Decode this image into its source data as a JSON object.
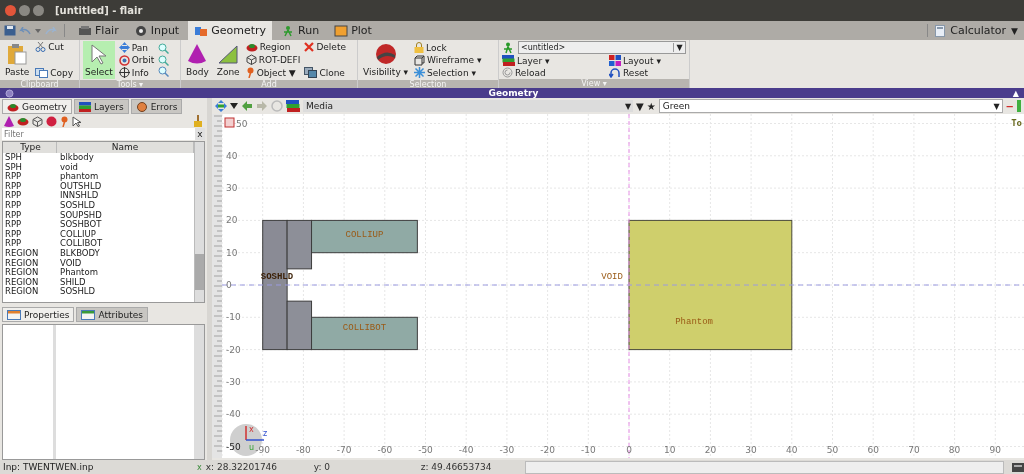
{
  "window": {
    "title": "[untitled] - flair"
  },
  "tabs": [
    {
      "label": "Flair",
      "selected": false
    },
    {
      "label": "Input",
      "selected": false
    },
    {
      "label": "Geometry",
      "selected": true
    },
    {
      "label": "Run",
      "selected": false
    },
    {
      "label": "Plot",
      "selected": false
    }
  ],
  "calculator": {
    "label": "Calculator",
    "caret": "▼"
  },
  "ribbon": {
    "clipboard": {
      "label": "Clipboard",
      "paste": "Paste",
      "cut": "Cut",
      "copy": "Copy"
    },
    "tools": {
      "label": "Tools ▾",
      "select": {
        "label": "Select",
        "selected": true
      },
      "pan": "Pan",
      "orbit": "Orbit",
      "info": "Info"
    },
    "add": {
      "label": "Add",
      "body": "Body",
      "zone": "Zone",
      "region": "Region",
      "rot_defi": "ROT-DEFI",
      "object": "Object ▼",
      "delete": "Delete",
      "clone": "Clone"
    },
    "selection": {
      "label": "Selection",
      "visibility": "Visibility ▾",
      "lock": "Lock",
      "wireframe": "Wireframe ▾",
      "selection": "Selection ▾"
    },
    "view": {
      "label": "View ▾",
      "combo": "<untitled>",
      "combo_caret": "▼",
      "layer": "Layer ▾",
      "layout": "Layout ▾",
      "reload": "Reload",
      "reset": "Reset"
    }
  },
  "panel_bar": {
    "title": "Geometry",
    "collapse": "▲"
  },
  "left_tabs": [
    {
      "label": "Geometry",
      "selected": true
    },
    {
      "label": "Layers",
      "selected": false
    },
    {
      "label": "Errors",
      "selected": false
    }
  ],
  "filter": {
    "placeholder": "Filter",
    "clear": "x"
  },
  "table": {
    "columns": [
      "Type",
      "Name"
    ],
    "rows": [
      {
        "type": "SPH",
        "name": "blkbody"
      },
      {
        "type": "SPH",
        "name": "void"
      },
      {
        "type": "RPP",
        "name": "phantom"
      },
      {
        "type": "RPP",
        "name": "OUTSHLD"
      },
      {
        "type": "RPP",
        "name": "INNSHLD"
      },
      {
        "type": "RPP",
        "name": "SOSHLD"
      },
      {
        "type": "RPP",
        "name": "SOUPSHD"
      },
      {
        "type": "RPP",
        "name": "SOSHBOT"
      },
      {
        "type": "RPP",
        "name": "COLLIUP"
      },
      {
        "type": "RPP",
        "name": "COLLIBOT"
      },
      {
        "type": "REGION",
        "name": "BLKBODY"
      },
      {
        "type": "REGION",
        "name": "VOID"
      },
      {
        "type": "REGION",
        "name": "Phantom"
      },
      {
        "type": "REGION",
        "name": "SHILD"
      },
      {
        "type": "REGION",
        "name": "SOSHLD"
      }
    ]
  },
  "bottom_tabs": [
    {
      "label": "Properties",
      "selected": true
    },
    {
      "label": "Attributes",
      "selected": false
    }
  ],
  "viewer": {
    "media": "Media",
    "media_caret": "▼",
    "color_caret": "▼",
    "star": "★",
    "color_name": "Green",
    "color_caret2": "▼",
    "remove": "−",
    "corner_text": "To",
    "x_ticks": [
      "-90",
      "-80",
      "-70",
      "-60",
      "-50",
      "-40",
      "-30",
      "-20",
      "-10",
      "0",
      "10",
      "20",
      "30",
      "40",
      "50",
      "60",
      "70",
      "80",
      "90"
    ],
    "y_ticks": [
      "50",
      "40",
      "30",
      "20",
      "10",
      "0",
      "-10",
      "-20",
      "-30",
      "-40",
      "-50"
    ],
    "zones": [
      {
        "name": "SOSHLD"
      },
      {
        "name": "COLLIUP"
      },
      {
        "name": "COLLIBOT"
      },
      {
        "name": "VOID"
      },
      {
        "name": "Phantom"
      }
    ],
    "axes": {
      "x": "x",
      "y": "u",
      "z": "z"
    }
  },
  "status_bar": {
    "input": "Inp: TWENTWEN.inp",
    "close": "x",
    "x": "x: 28.32201746",
    "y": "y: 0",
    "z": "z: 49.46653734"
  }
}
